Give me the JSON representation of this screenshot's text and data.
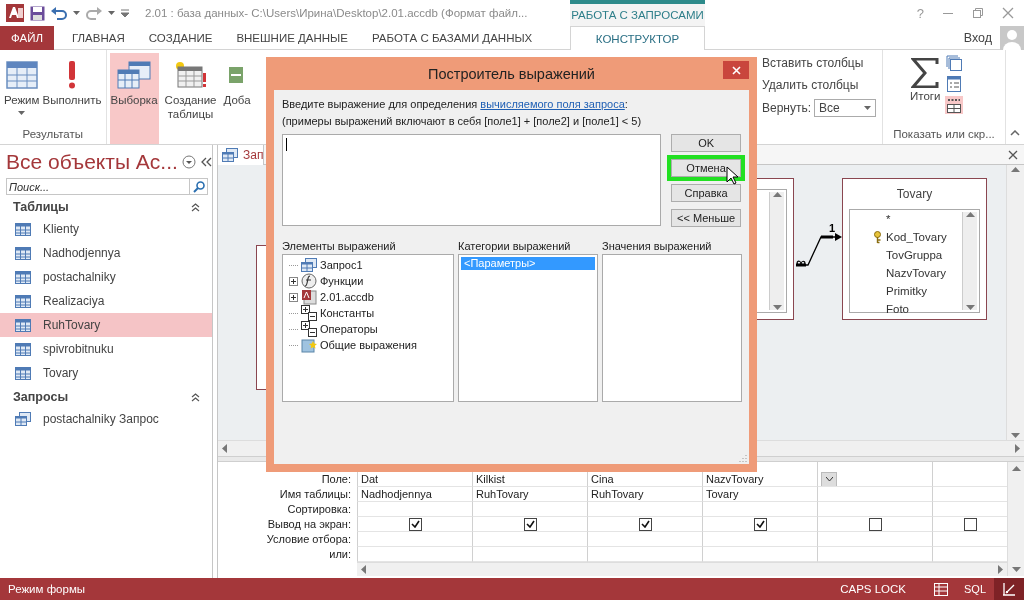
{
  "title_bar": {
    "title": "2.01 : база данных- C:\\Users\\Ирина\\Desktop\\2.01.accdb (Формат файл...",
    "context_tab": "РАБОТА С ЗАПРОСАМИ",
    "help": "?"
  },
  "ribbon_tabs": [
    {
      "label": "ФАЙЛ",
      "kind": "file",
      "selected": false
    },
    {
      "label": "ГЛАВНАЯ",
      "kind": "tab",
      "selected": false
    },
    {
      "label": "СОЗДАНИЕ",
      "kind": "tab",
      "selected": false
    },
    {
      "label": "ВНЕШНИЕ ДАННЫЕ",
      "kind": "tab",
      "selected": false
    },
    {
      "label": "РАБОТА С БАЗАМИ ДАННЫХ",
      "kind": "tab",
      "selected": false
    },
    {
      "label": "КОНСТРУКТОР",
      "kind": "contextual",
      "selected": true
    }
  ],
  "account": {
    "label": "Вход"
  },
  "ribbon": {
    "groups": [
      {
        "label": "Результаты",
        "buttons": [
          {
            "label": "Режим",
            "kind": "view",
            "menu": true
          },
          {
            "label": "Выполнить",
            "kind": "run"
          }
        ]
      },
      {
        "buttons": [
          {
            "label": "Выборка",
            "kind": "select",
            "selected": true
          },
          {
            "label": "Создание таблицы",
            "kind": "make_table",
            "selected": false
          },
          {
            "label": "Доба",
            "kind": "append",
            "selected": false
          }
        ]
      }
    ],
    "query_setup": {
      "items": [
        "Вставить столбцы",
        "Удалить столбцы"
      ],
      "return_label": "Вернуть:",
      "return_value": "Все"
    },
    "show_hide": {
      "label": "Показать или скр...",
      "totals": "Итоги",
      "toggles": [
        {
          "kind": "parameters",
          "on": false
        },
        {
          "kind": "property_sheet",
          "on": false
        },
        {
          "kind": "table_names",
          "on": true
        }
      ]
    }
  },
  "navigation": {
    "title": "Все объекты Ac...",
    "search_placeholder": "Поиск...",
    "groups": [
      {
        "label": "Таблицы",
        "items": [
          {
            "label": "Klienty",
            "kind": "table",
            "selected": false
          },
          {
            "label": "Nadhodjennya",
            "kind": "table",
            "selected": false
          },
          {
            "label": "postachalniky",
            "kind": "table",
            "selected": false
          },
          {
            "label": "Realizaciya",
            "kind": "table",
            "selected": false
          },
          {
            "label": "RuhTovary",
            "kind": "table",
            "selected": true
          },
          {
            "label": "spivrobitnuku",
            "kind": "table",
            "selected": false
          },
          {
            "label": "Tovary",
            "kind": "table",
            "selected": false
          }
        ]
      },
      {
        "label": "Запросы",
        "items": [
          {
            "label": "postachalniky Запрос",
            "kind": "query",
            "selected": false
          }
        ]
      }
    ]
  },
  "document": {
    "tab_label": "Зап",
    "tables": [
      {
        "title": "Tovary",
        "fields": [
          {
            "label": "*",
            "key": false
          },
          {
            "label": "Kod_Tovary",
            "key": true
          },
          {
            "label": "TovGruppa",
            "key": false
          },
          {
            "label": "NazvTovary",
            "key": false
          },
          {
            "label": "Primitky",
            "key": false
          },
          {
            "label": "Foto",
            "key": false
          }
        ]
      }
    ],
    "relationship": {
      "one": "1",
      "many": "∞"
    }
  },
  "design_grid": {
    "row_labels": [
      "Поле:",
      "Имя таблицы:",
      "Сортировка:",
      "Вывод на экран:",
      "Условие отбора:",
      "или:"
    ],
    "columns": [
      {
        "field": "Dat",
        "table": "Nadhodjennya",
        "show": true,
        "focused": false
      },
      {
        "field": "Kilkist",
        "table": "RuhTovary",
        "show": true,
        "focused": false
      },
      {
        "field": "Cina",
        "table": "RuhTovary",
        "show": true,
        "focused": false
      },
      {
        "field": "NazvTovary",
        "table": "Tovary",
        "show": true,
        "focused": false
      },
      {
        "show": false,
        "focused": true
      },
      {
        "show": false,
        "focused": false
      }
    ]
  },
  "dialog": {
    "title": "Построитель выражений",
    "prompt": "Введите выражение для определения ",
    "prompt_link": "вычисляемого поля запроса",
    "prompt_end": ":",
    "examples": "(примеры выражений включают в себя [поле1] + [поле2] и [поле1] < 5)",
    "buttons": [
      {
        "label": "OK",
        "highlighted": false
      },
      {
        "label": "Отмена",
        "highlighted": true
      },
      {
        "label": "Справка",
        "highlighted": false
      },
      {
        "label": "<< Меньше",
        "highlighted": false
      }
    ],
    "elements_label": "Элементы выражений",
    "categories_label": "Категории выражений",
    "values_label": "Значения выражений",
    "elements": [
      {
        "label": "Запрос1",
        "kind": "query"
      },
      {
        "label": "Функции",
        "kind": "functions",
        "expanded": false
      },
      {
        "label": "2.01.accdb",
        "kind": "database",
        "expanded": false
      },
      {
        "label": "Константы",
        "kind": "constants"
      },
      {
        "label": "Операторы",
        "kind": "operators"
      },
      {
        "label": "Общие выражения",
        "kind": "common"
      }
    ],
    "categories": [
      {
        "label": "<Параметры>",
        "selected": true
      }
    ]
  },
  "status_bar": {
    "mode": "Режим формы",
    "caps": "CAPS LOCK",
    "views": [
      {
        "kind": "datasheet",
        "selected": false
      },
      {
        "kind": "sql",
        "label": "SQL",
        "selected": false
      },
      {
        "kind": "design",
        "selected": true
      }
    ]
  }
}
